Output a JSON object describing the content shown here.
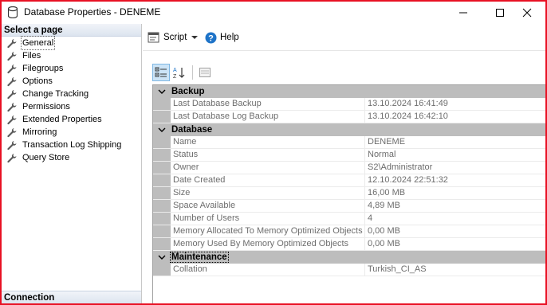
{
  "window": {
    "title": "Database Properties - DENEME",
    "minimize_icon": "minimize-icon",
    "maximize_icon": "maximize-icon",
    "close_icon": "close-icon"
  },
  "left_pane": {
    "header": "Select a page",
    "items": [
      {
        "label": "General",
        "icon": "wrench-icon",
        "selected": true
      },
      {
        "label": "Files",
        "icon": "wrench-icon"
      },
      {
        "label": "Filegroups",
        "icon": "wrench-icon"
      },
      {
        "label": "Options",
        "icon": "wrench-icon"
      },
      {
        "label": "Change Tracking",
        "icon": "wrench-icon"
      },
      {
        "label": "Permissions",
        "icon": "wrench-icon"
      },
      {
        "label": "Extended Properties",
        "icon": "wrench-icon"
      },
      {
        "label": "Mirroring",
        "icon": "wrench-icon"
      },
      {
        "label": "Transaction Log Shipping",
        "icon": "wrench-icon"
      },
      {
        "label": "Query Store",
        "icon": "wrench-icon"
      }
    ],
    "connection_header": "Connection"
  },
  "toolbar": {
    "script_label": "Script",
    "help_label": "Help"
  },
  "property_grid": {
    "categories": [
      {
        "name": "Backup",
        "rows": [
          {
            "name": "Last Database Backup",
            "value": "13.10.2024 16:41:49"
          },
          {
            "name": "Last Database Log Backup",
            "value": "13.10.2024 16:42:10"
          }
        ]
      },
      {
        "name": "Database",
        "rows": [
          {
            "name": "Name",
            "value": "DENEME"
          },
          {
            "name": "Status",
            "value": "Normal"
          },
          {
            "name": "Owner",
            "value": "S2\\Administrator"
          },
          {
            "name": "Date Created",
            "value": "12.10.2024 22:51:32"
          },
          {
            "name": "Size",
            "value": "16,00 MB"
          },
          {
            "name": "Space Available",
            "value": "4,89 MB"
          },
          {
            "name": "Number of Users",
            "value": "4"
          },
          {
            "name": "Memory Allocated To Memory Optimized Objects",
            "value": "0,00 MB"
          },
          {
            "name": "Memory Used By Memory Optimized Objects",
            "value": "0,00 MB"
          }
        ]
      },
      {
        "name": "Maintenance",
        "rows": [
          {
            "name": "Collation",
            "value": "Turkish_CI_AS"
          }
        ]
      }
    ]
  }
}
